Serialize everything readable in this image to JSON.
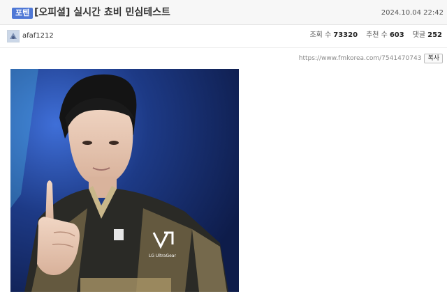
{
  "header": {
    "category_badge": "포텐",
    "title": "[오피셜] 실시간 쵸비 민심테스트",
    "date": "2024.10.04 22:42"
  },
  "meta": {
    "author": "afaf1212",
    "stats": [
      {
        "label": "조회 수",
        "value": "73320"
      },
      {
        "label": "추천 수",
        "value": "603"
      },
      {
        "label": "댓글",
        "value": "252"
      }
    ]
  },
  "link": {
    "url": "https://www.fmkorea.com/7541470743",
    "copy_label": "복사"
  },
  "image": {
    "jersey_logo_text": "LG UltraGear"
  },
  "colors": {
    "badge": "#4f78d6",
    "background_blue": "#1d3a86",
    "jersey_gold": "#a89466"
  }
}
